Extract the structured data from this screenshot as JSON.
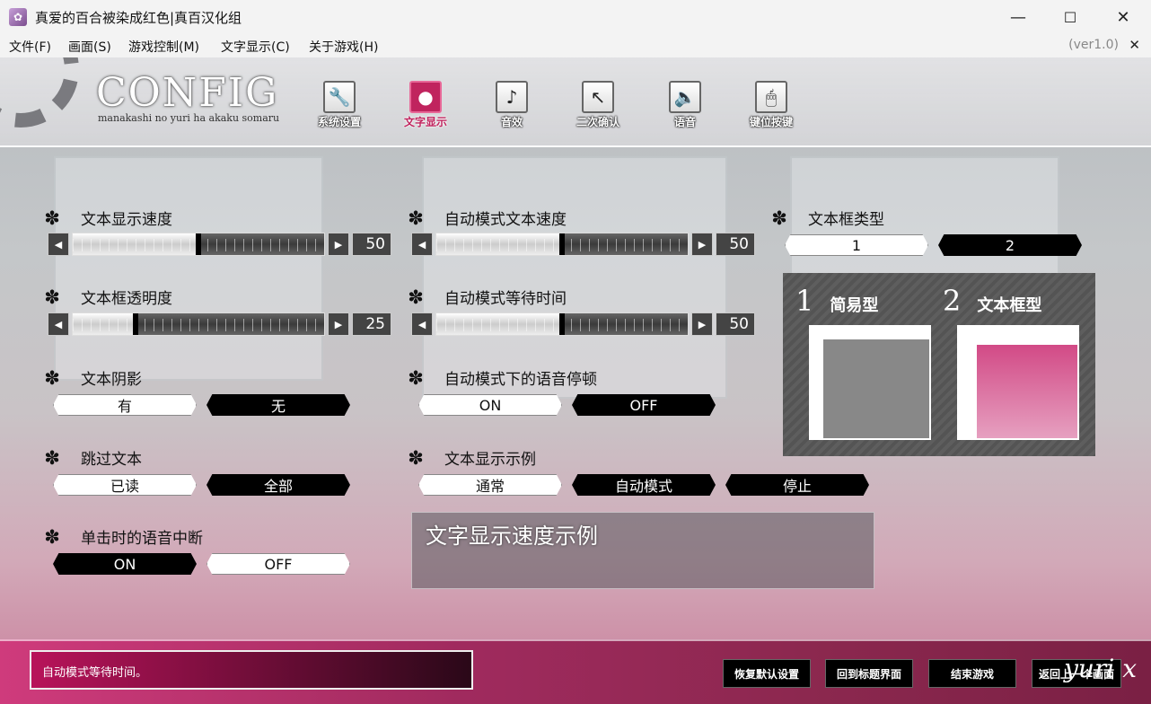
{
  "window": {
    "title": "真爱的百合被染成红色|真百汉化组",
    "minimize": "—",
    "maximize": "☐",
    "close": "✕"
  },
  "menubar": {
    "items": [
      "文件(F)",
      "画面(S)",
      "游戏控制(M)",
      "文字显示(C)",
      "关于游戏(H)"
    ],
    "version": "(ver1.0)",
    "close": "✕"
  },
  "header": {
    "title": "CONFIG",
    "subtitle": "manakashi no yuri ha akaku somaru",
    "tabs": [
      {
        "label": "系统设置",
        "icon": "wrench-icon",
        "glyph": "🔧"
      },
      {
        "label": "文字显示",
        "icon": "speech-bubble-icon",
        "glyph": "●"
      },
      {
        "label": "音效",
        "icon": "music-note-icon",
        "glyph": "♪"
      },
      {
        "label": "二次确认",
        "icon": "cursor-icon",
        "glyph": "↖"
      },
      {
        "label": "语音",
        "icon": "speaker-icon",
        "glyph": "🔈"
      },
      {
        "label": "键位按键",
        "icon": "mouse-icon",
        "glyph": "🖱"
      }
    ],
    "active_tab": 1
  },
  "settings": {
    "text_speed": {
      "title": "文本显示速度",
      "value": "50",
      "level": 0.5
    },
    "box_opacity": {
      "title": "文本框透明度",
      "value": "25",
      "level": 0.25
    },
    "text_shadow": {
      "title": "文本阴影",
      "options": [
        "有",
        "无"
      ],
      "selected": 1
    },
    "skip": {
      "title": "跳过文本",
      "options": [
        "已读",
        "全部"
      ],
      "selected": 1
    },
    "voice_interrupt": {
      "title": "单击时的语音中断",
      "options": [
        "ON",
        "OFF"
      ],
      "selected": 0
    },
    "auto_speed": {
      "title": "自动模式文本速度",
      "value": "50",
      "level": 0.5
    },
    "auto_wait": {
      "title": "自动模式等待时间",
      "value": "50",
      "level": 0.5
    },
    "auto_voice_pause": {
      "title": "自动模式下的语音停顿",
      "options": [
        "ON",
        "OFF"
      ],
      "selected": 1
    },
    "sample": {
      "title": "文本显示示例",
      "options": [
        "通常",
        "自动模式",
        "停止"
      ],
      "selected": [
        1,
        2
      ],
      "text": "文字显示速度示例"
    },
    "box_type": {
      "title": "文本框类型",
      "options": [
        "1",
        "2"
      ],
      "selected": 1
    },
    "preview": {
      "num1": "1",
      "label1": "简易型",
      "num2": "2",
      "label2": "文本框型"
    }
  },
  "footer": {
    "help": "自动模式等待时间。",
    "buttons": [
      "恢复默认设置",
      "回到标题界面",
      "结束游戏",
      "返回上一个画面"
    ],
    "signature": "yuri x"
  },
  "arrows": {
    "left": "◀",
    "right": "▶"
  },
  "flower_glyph": "✽",
  "colors": {
    "accent": "#c0245e",
    "footer": "#a02a5e"
  }
}
